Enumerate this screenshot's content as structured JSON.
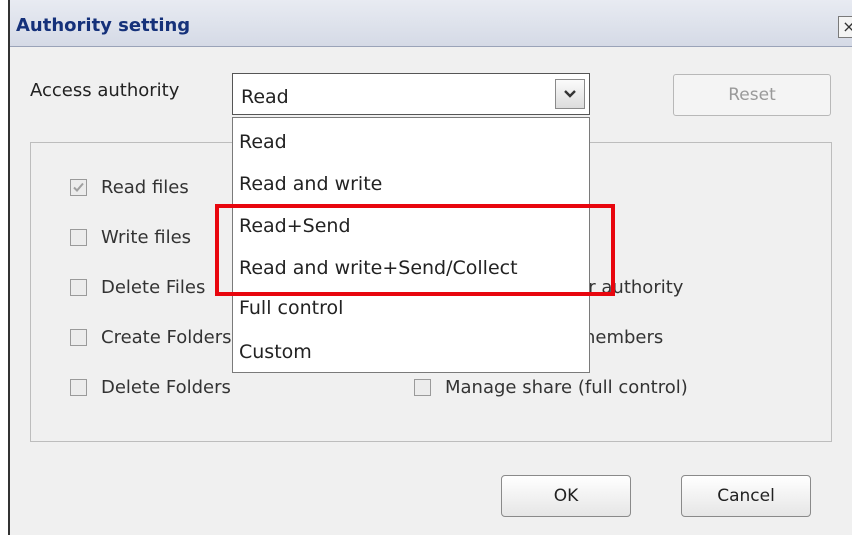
{
  "dialog": {
    "title": "Authority setting",
    "close_label": "×"
  },
  "access": {
    "label": "Access authority",
    "selected_value": "Read",
    "reset_label": "Reset"
  },
  "dropdown": {
    "options": [
      "Read",
      "Read and write",
      "Read+Send",
      "Read and write+Send/Collect",
      "Full control",
      "Custom"
    ]
  },
  "permissions": {
    "left": [
      {
        "label": "Read files",
        "checked": true,
        "disabled": true
      },
      {
        "label": "Write files",
        "checked": false
      },
      {
        "label": "Delete Files",
        "checked": false
      },
      {
        "label": "Create Folders",
        "checked": false
      },
      {
        "label": "Delete Folders",
        "checked": false
      }
    ],
    "right": [
      {
        "label": "Change member authority",
        "checked": false
      },
      {
        "label": "Manage share members",
        "checked": false
      },
      {
        "label": "Manage share (full control)",
        "checked": false
      }
    ]
  },
  "buttons": {
    "ok": "OK",
    "cancel": "Cancel"
  },
  "colors": {
    "title_text": "#15317a",
    "highlight_box": "#e8060e"
  }
}
